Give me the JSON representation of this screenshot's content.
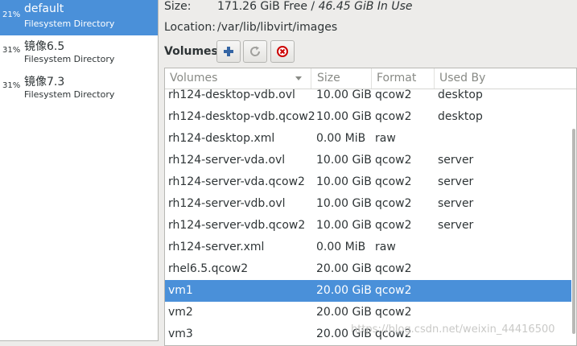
{
  "pools": [
    {
      "usage": "21%",
      "name": "default",
      "type": "Filesystem Directory",
      "selected": true
    },
    {
      "usage": "31%",
      "name": "镜像6.5",
      "type": "Filesystem Directory",
      "selected": false
    },
    {
      "usage": "31%",
      "name": "镜像7.3",
      "type": "Filesystem Directory",
      "selected": false
    }
  ],
  "details": {
    "size_label": "Size:",
    "size_free": "171.26 GiB Free",
    "size_sep": " / ",
    "size_in_use": "46.45 GiB In Use",
    "location_label": "Location:",
    "location_value": "/var/lib/libvirt/images"
  },
  "toolbar": {
    "title": "Volumes",
    "add_icon": "plus-icon",
    "refresh_icon": "refresh-icon",
    "delete_icon": "delete-icon"
  },
  "table": {
    "columns": [
      "Volumes",
      "Size",
      "Format",
      "Used By"
    ],
    "rows": [
      {
        "name": "rh124-desktop-vdb.ovl",
        "size": "10.00 GiB",
        "format": "qcow2",
        "used_by": "desktop"
      },
      {
        "name": "rh124-desktop-vdb.qcow2",
        "size": "10.00 GiB",
        "format": "qcow2",
        "used_by": "desktop"
      },
      {
        "name": "rh124-desktop.xml",
        "size": "0.00 MiB",
        "format": "raw",
        "used_by": ""
      },
      {
        "name": "rh124-server-vda.ovl",
        "size": "10.00 GiB",
        "format": "qcow2",
        "used_by": "server"
      },
      {
        "name": "rh124-server-vda.qcow2",
        "size": "10.00 GiB",
        "format": "qcow2",
        "used_by": "server"
      },
      {
        "name": "rh124-server-vdb.ovl",
        "size": "10.00 GiB",
        "format": "qcow2",
        "used_by": "server"
      },
      {
        "name": "rh124-server-vdb.qcow2",
        "size": "10.00 GiB",
        "format": "qcow2",
        "used_by": "server"
      },
      {
        "name": "rh124-server.xml",
        "size": "0.00 MiB",
        "format": "raw",
        "used_by": ""
      },
      {
        "name": "rhel6.5.qcow2",
        "size": "20.00 GiB",
        "format": "qcow2",
        "used_by": ""
      },
      {
        "name": "vm1",
        "size": "20.00 GiB",
        "format": "qcow2",
        "used_by": "",
        "selected": true
      },
      {
        "name": "vm2",
        "size": "20.00 GiB",
        "format": "qcow2",
        "used_by": ""
      },
      {
        "name": "vm3",
        "size": "20.00 GiB",
        "format": "qcow2",
        "used_by": ""
      }
    ]
  },
  "watermark": "https://blog.csdn.net/weixin_44416500",
  "colors": {
    "selection": "#4a90d9",
    "background": "#edecea"
  }
}
